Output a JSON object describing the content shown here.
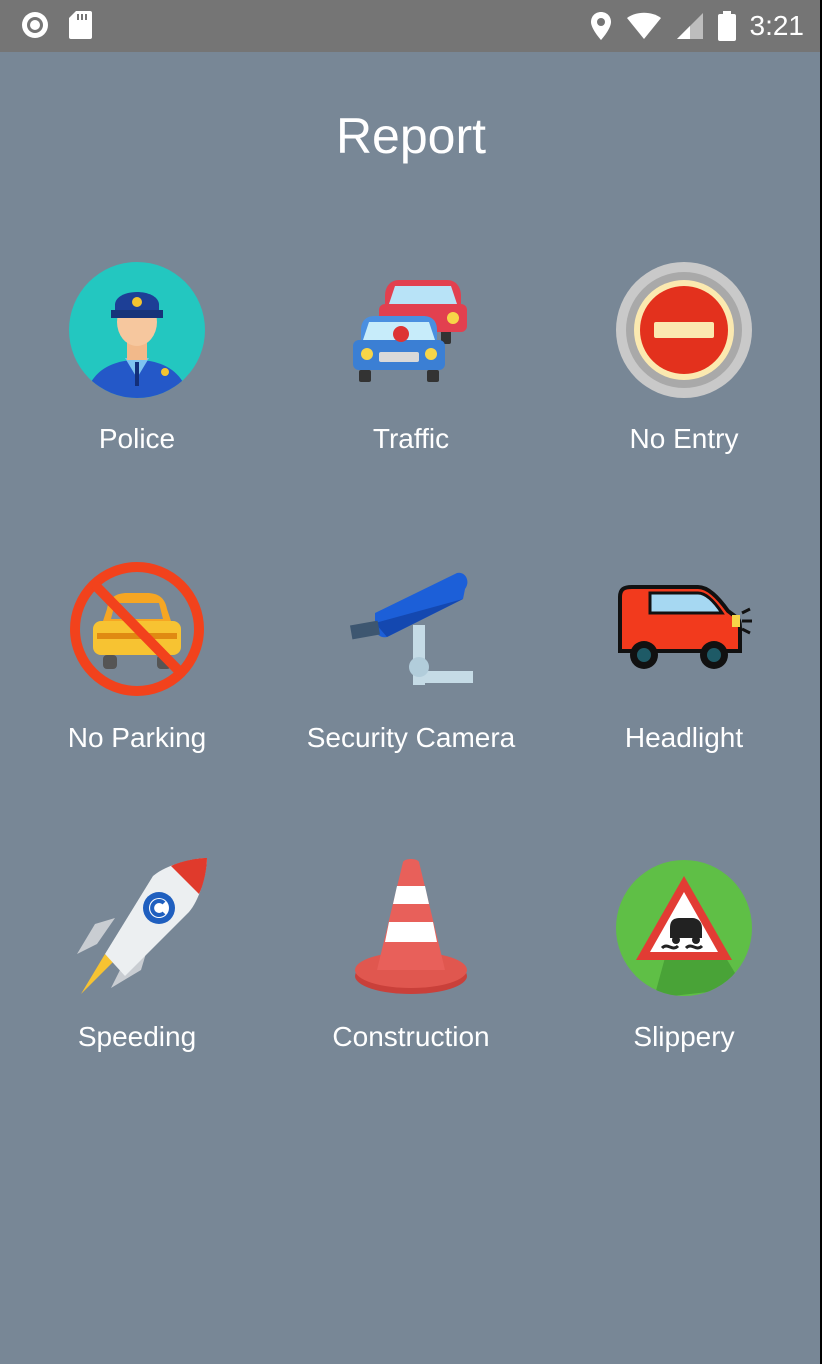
{
  "status_bar": {
    "time": "3:21",
    "left_icons": [
      "record-icon",
      "sd-card-icon"
    ],
    "right_icons": [
      "location-icon",
      "wifi-icon",
      "signal-icon",
      "battery-icon"
    ]
  },
  "header": {
    "title": "Report"
  },
  "colors": {
    "background": "#788796",
    "status_bar": "#757575",
    "text": "#ffffff"
  },
  "reports": [
    {
      "label": "Police",
      "icon": "police-officer-icon"
    },
    {
      "label": "Traffic",
      "icon": "traffic-cars-icon"
    },
    {
      "label": "No Entry",
      "icon": "no-entry-sign-icon"
    },
    {
      "label": "No Parking",
      "icon": "no-parking-sign-icon"
    },
    {
      "label": "Security Camera",
      "icon": "security-camera-icon"
    },
    {
      "label": "Headlight",
      "icon": "headlight-car-icon"
    },
    {
      "label": "Speeding",
      "icon": "rocket-icon"
    },
    {
      "label": "Construction",
      "icon": "traffic-cone-icon"
    },
    {
      "label": "Slippery",
      "icon": "slippery-road-sign-icon"
    }
  ]
}
